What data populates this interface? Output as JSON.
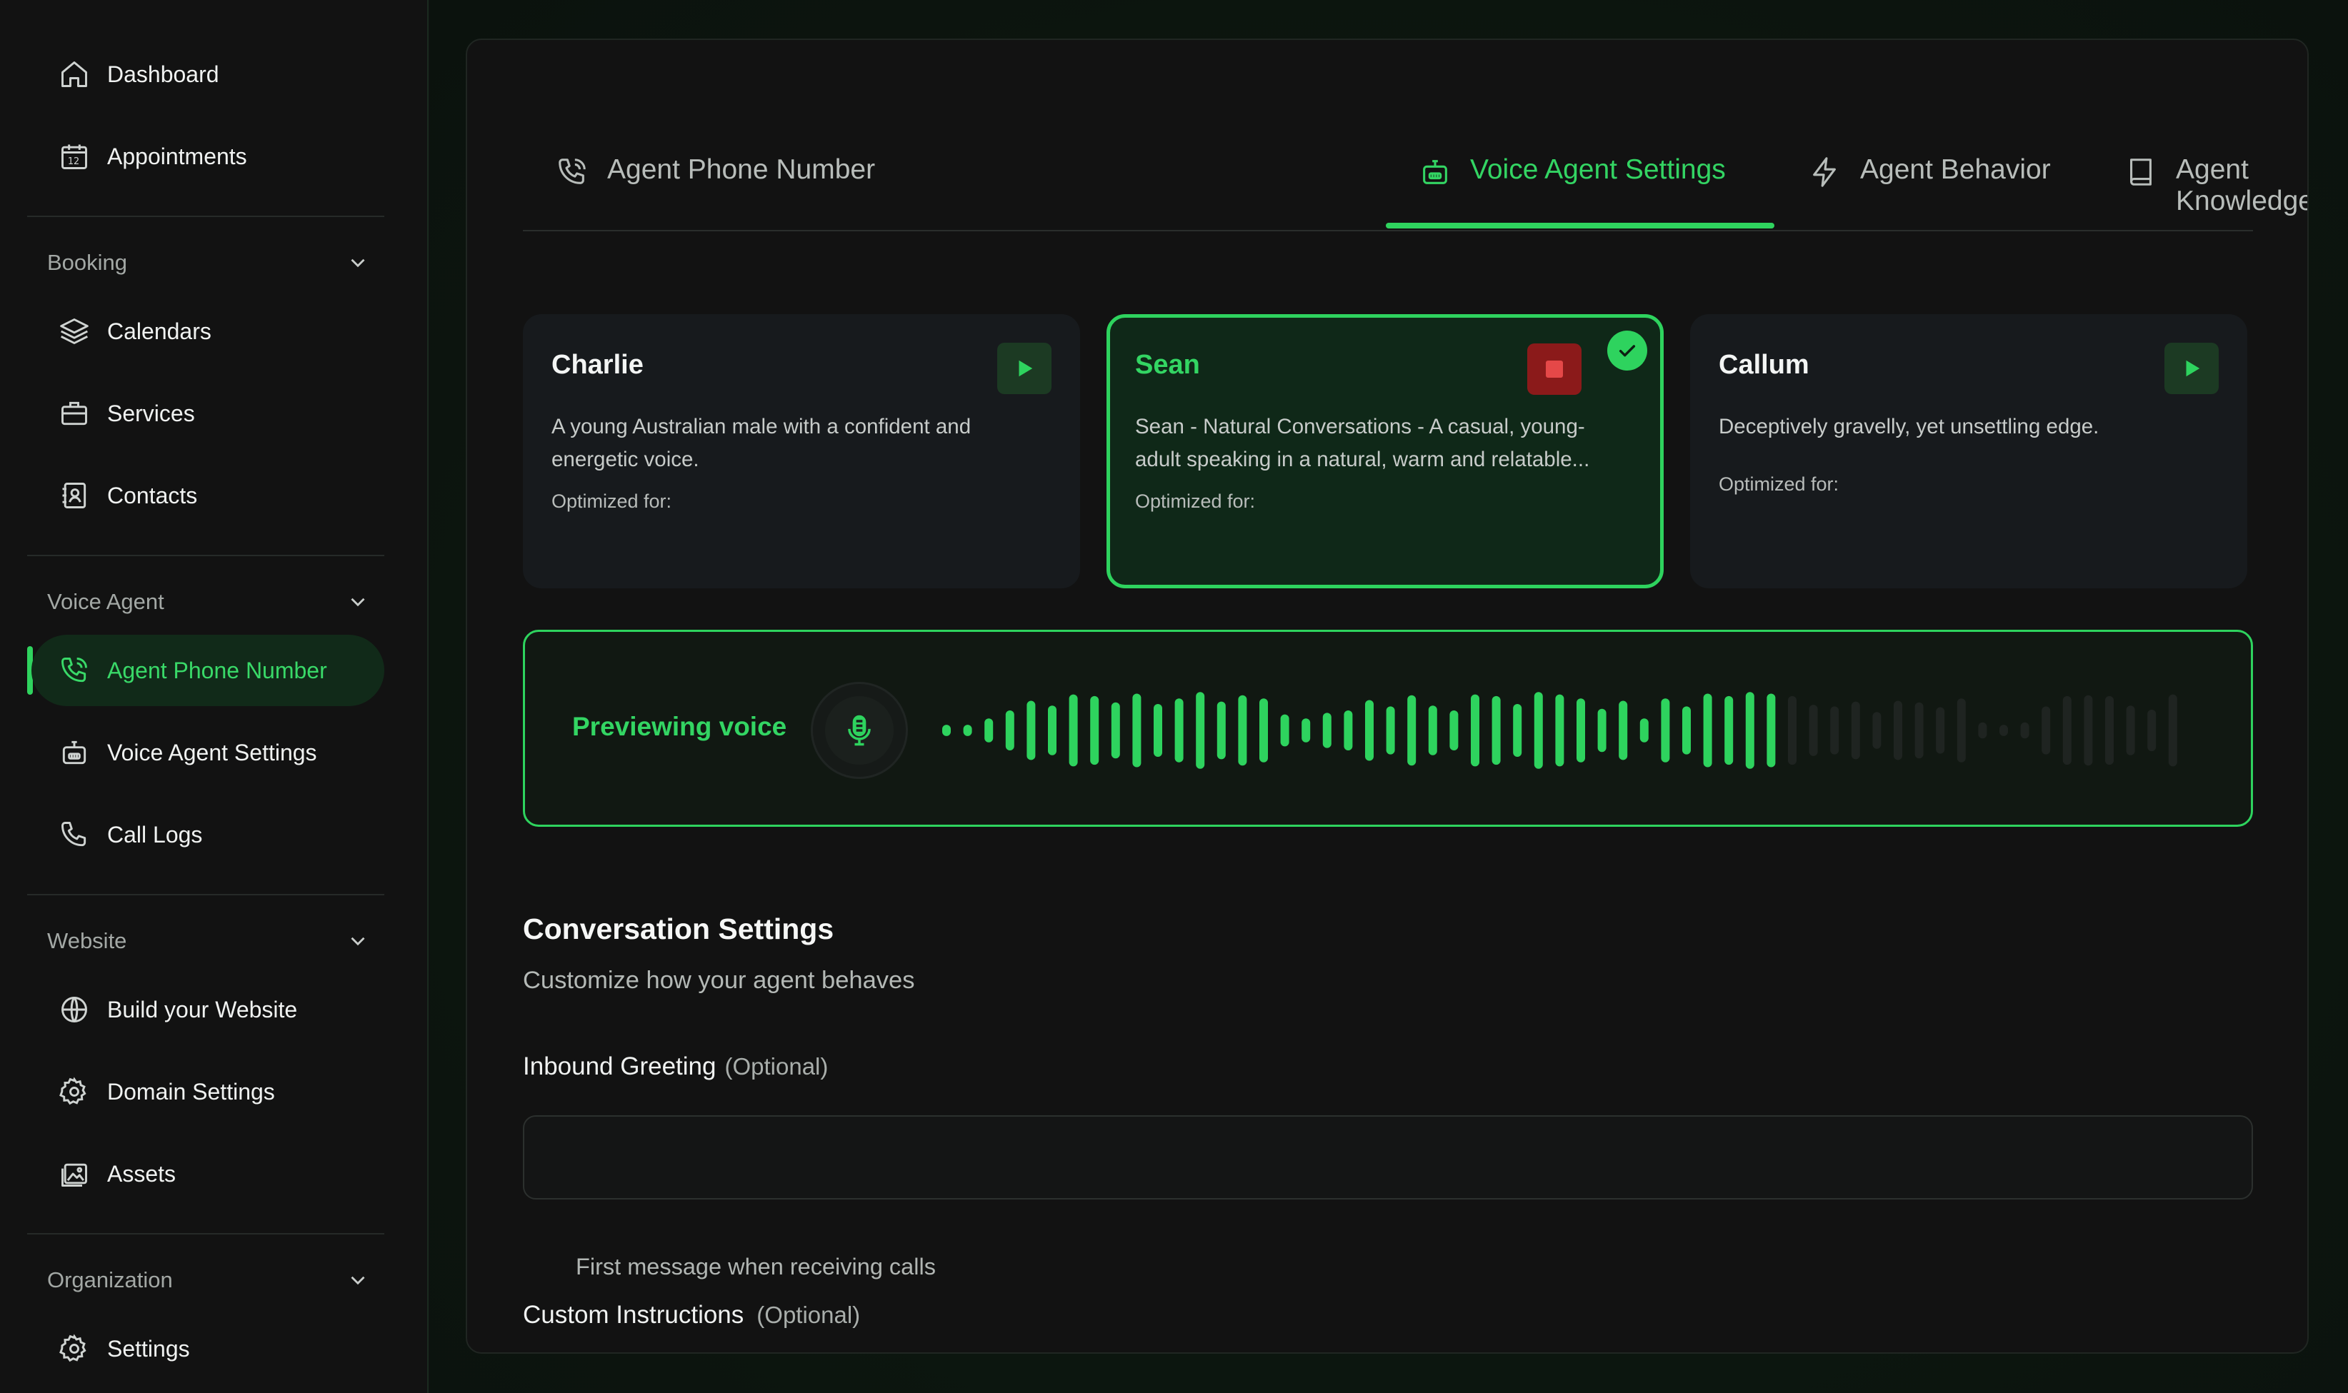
{
  "sidebar": {
    "items_top": [
      {
        "label": "Dashboard",
        "icon": "home-icon"
      },
      {
        "label": "Appointments",
        "icon": "calendar-date-icon"
      }
    ],
    "groups": [
      {
        "label": "Booking",
        "items": [
          {
            "label": "Calendars",
            "icon": "layers-icon"
          },
          {
            "label": "Services",
            "icon": "briefcase-icon"
          },
          {
            "label": "Contacts",
            "icon": "contact-book-icon"
          }
        ]
      },
      {
        "label": "Voice Agent",
        "items": [
          {
            "label": "Agent Phone Number",
            "icon": "phone-call-icon",
            "active": true
          },
          {
            "label": "Voice Agent Settings",
            "icon": "robot-icon"
          },
          {
            "label": "Call Logs",
            "icon": "phone-icon"
          }
        ]
      },
      {
        "label": "Website",
        "items": [
          {
            "label": "Build your Website",
            "icon": "globe-icon"
          },
          {
            "label": "Domain Settings",
            "icon": "gear-icon"
          },
          {
            "label": "Assets",
            "icon": "image-icon"
          }
        ]
      },
      {
        "label": "Organization",
        "items": [
          {
            "label": "Settings",
            "icon": "gear-icon"
          }
        ]
      }
    ]
  },
  "tabs": [
    {
      "label": "Agent Phone Number",
      "icon": "phone-call-icon"
    },
    {
      "label": "Voice Agent Settings",
      "icon": "robot-icon",
      "active": true
    },
    {
      "label": "Agent Behavior",
      "icon": "lightning-icon"
    },
    {
      "label": "Agent Knowledge",
      "icon": "book-icon"
    }
  ],
  "voices": [
    {
      "name": "Charlie",
      "description": "A young Australian male with a confident and energetic voice.",
      "optimized_label": "Optimized for:",
      "state": "idle"
    },
    {
      "name": "Sean",
      "description": "Sean - Natural Conversations - A casual, young-adult speaking in a natural, warm and relatable...",
      "optimized_label": "Optimized for:",
      "state": "playing-selected"
    },
    {
      "name": "Callum",
      "description": "Deceptively gravelly, yet unsettling edge.",
      "optimized_label": "Optimized for:",
      "state": "idle"
    }
  ],
  "preview": {
    "label": "Previewing voice",
    "progress": 0.68
  },
  "conversation": {
    "title": "Conversation Settings",
    "subtitle": "Customize how your agent behaves",
    "greeting_label": "Inbound Greeting",
    "greeting_optional": "(Optional)",
    "greeting_value": "",
    "greeting_helper": "First message when receiving calls",
    "instructions_label": "Custom Instructions",
    "instructions_optional": "(Optional)"
  },
  "colors": {
    "accent": "#2ed35e",
    "background": "#121212",
    "stop": "#8b1a1a"
  }
}
